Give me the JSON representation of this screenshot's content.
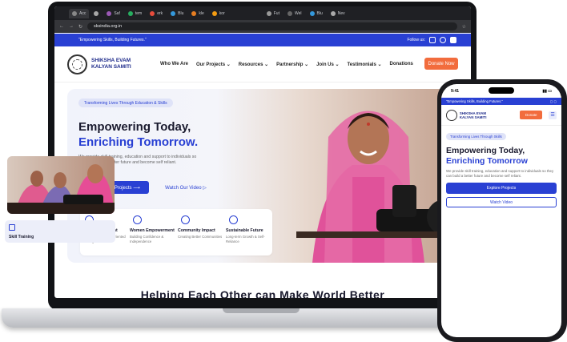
{
  "browser": {
    "tabs": [
      "Acc",
      "Saf",
      "tem",
      "erk",
      "Blu",
      "kle",
      "kor",
      "Fut",
      "Wel",
      "Blu",
      "Nev"
    ],
    "url": "sksindia.org.in"
  },
  "site": {
    "tagline": "\"Empowering Skills, Building Futures.\"",
    "follow_label": "Follow us:",
    "brand_line1": "SHIKSHA EVAM",
    "brand_line2": "KALYAN SAMITI",
    "menu": [
      "Who We Are",
      "Our Projects ⌄",
      "Resources ⌄",
      "Partnership ⌄",
      "Join Us ⌄",
      "Testimonials ⌄",
      "Donations"
    ],
    "donate_now": "Donate Now",
    "hero": {
      "pill": "Transforming Lives Through Education & Skills",
      "title_line1": "Empowering Today,",
      "title_line2": "Enriching Tomorrow.",
      "description": "We provide skill training, education and support to individuals so they can build a better future and become self reliant.",
      "explore_btn": "Explore Our Projects ⟶",
      "video_btn": "Watch Our Video ▷"
    },
    "features": [
      {
        "title": "Skill Development",
        "sub": "Practical & Industry Oriented Training"
      },
      {
        "title": "Women Empowerment",
        "sub": "Building Confidence & Independence"
      },
      {
        "title": "Community Impact",
        "sub": "Creating Better Communities"
      },
      {
        "title": "Sustainable Future",
        "sub": "Long-term Growth & Self-Reliance"
      }
    ],
    "section_headline": "Helping Each Other can Make World Better"
  },
  "phone": {
    "time": "9:41",
    "tagline": "\"Empowering Skills, Building Futures.\"",
    "brand_line1": "SHIKSHA EVAM",
    "brand_line2": "KALYAN SAMITI",
    "donate": "Donate",
    "menu_icon": "☰",
    "pill": "Transforming Lives Through Skills",
    "title_line1": "Empowering Today,",
    "title_line2": "Enriching Tomorrow",
    "description": "We provide skill training, education and support to individuals so they can build a better future and become self reliant.",
    "explore_btn": "Explore Projects",
    "video_btn": "Watch Video",
    "card_title": "Skill Training"
  },
  "colors": {
    "brand_blue": "#2940d3",
    "donate_orange": "#f26c3d"
  }
}
